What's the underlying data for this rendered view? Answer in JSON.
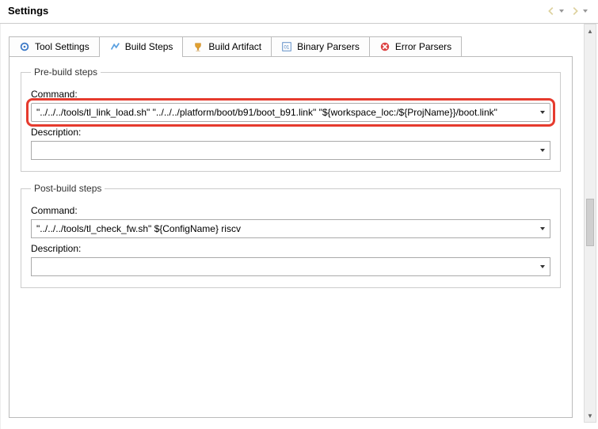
{
  "header": {
    "title": "Settings"
  },
  "tabs": [
    {
      "label": "Tool Settings"
    },
    {
      "label": "Build Steps"
    },
    {
      "label": "Build Artifact"
    },
    {
      "label": "Binary Parsers"
    },
    {
      "label": "Error Parsers"
    }
  ],
  "active_tab_index": 1,
  "pre_build": {
    "legend": "Pre-build steps",
    "command_label": "Command:",
    "command_value": "\"../../../tools/tl_link_load.sh\" \"../../../platform/boot/b91/boot_b91.link\" \"${workspace_loc:/${ProjName}}/boot.link\"",
    "description_label": "Description:",
    "description_value": ""
  },
  "post_build": {
    "legend": "Post-build steps",
    "command_label": "Command:",
    "command_value": "\"../../../tools/tl_check_fw.sh\" ${ConfigName} riscv",
    "description_label": "Description:",
    "description_value": ""
  }
}
